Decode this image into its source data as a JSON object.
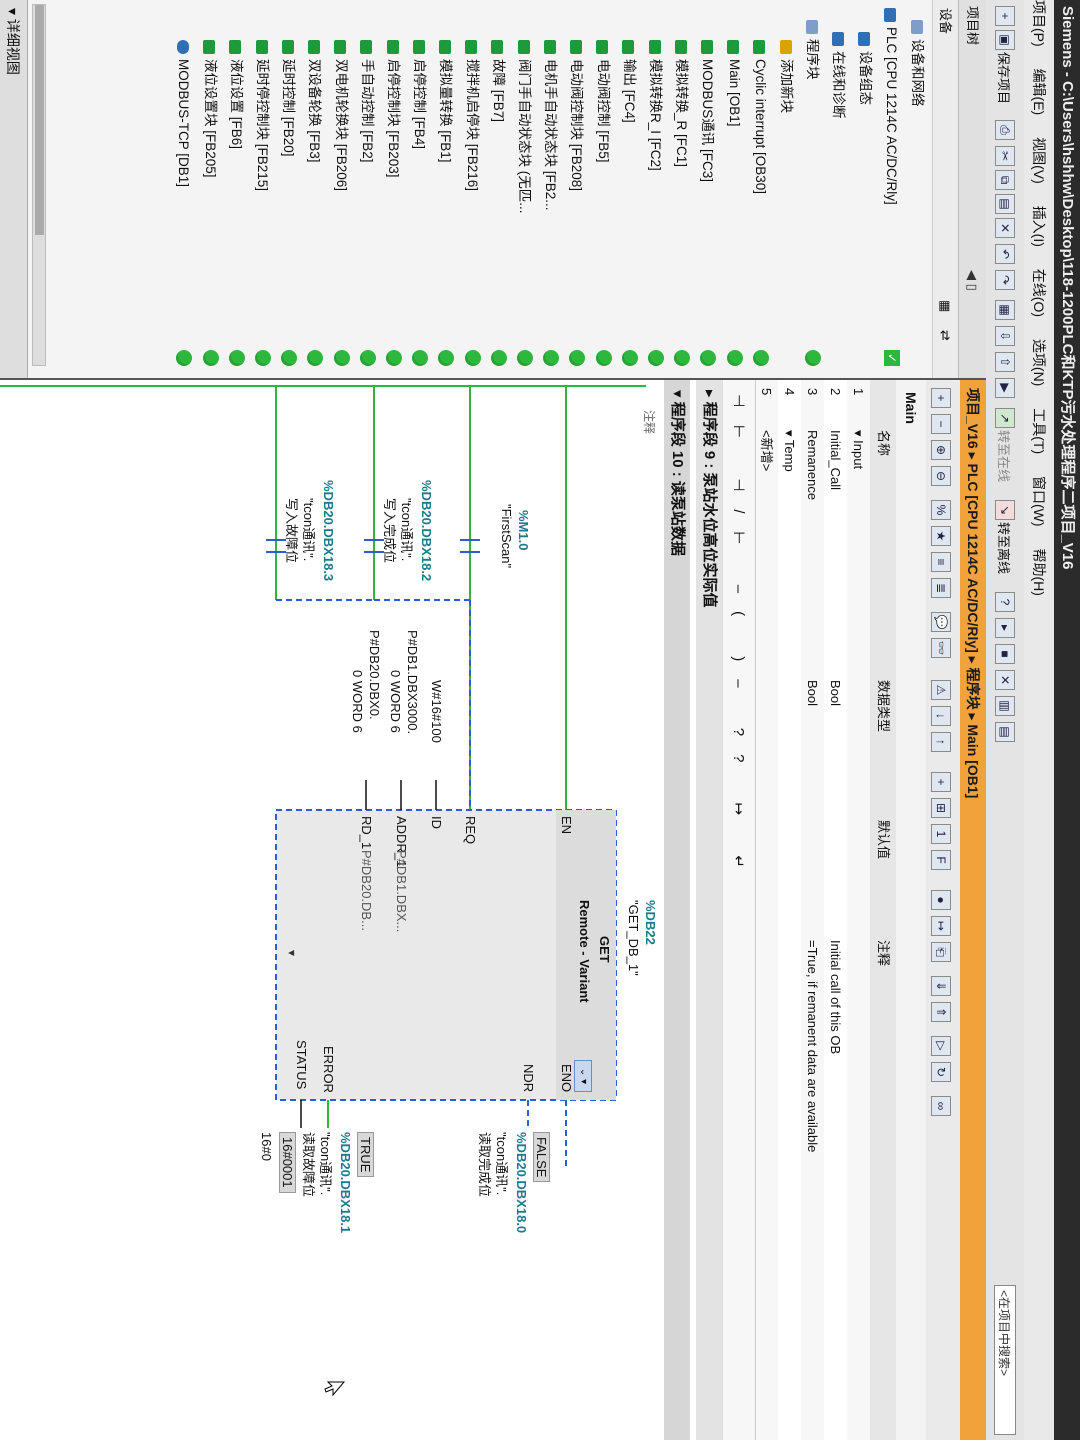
{
  "window": {
    "title": "Siemens  -  C:\\Users\\hshhw\\Desktop\\118-1200PLC和KTP污水处理程序二项目_V16"
  },
  "menu": [
    "项目(P)",
    "编辑(E)",
    "视图(V)",
    "插入(I)",
    "在线(O)",
    "选项(N)",
    "工具(T)",
    "窗口(W)",
    "帮助(H)"
  ],
  "toolbar": {
    "save_label": "保存项目",
    "go_online": "转至在线",
    "go_offline": "转至离线",
    "search_placeholder": "<在项目中搜索>"
  },
  "project_tree": {
    "header": "项目树",
    "device_tab": "设备",
    "items": [
      {
        "label": "设备和网络",
        "icon": "network-icon",
        "status": "none"
      },
      {
        "label": "PLC [CPU 1214C AC/DC/Rly]",
        "icon": "plc-icon",
        "status": "check"
      },
      {
        "label": "设备组态",
        "icon": "device-config-icon",
        "status": "none"
      },
      {
        "label": "在线和诊断",
        "icon": "diagnostics-icon",
        "status": "none"
      },
      {
        "label": "程序块",
        "icon": "folder-icon",
        "status": "green"
      },
      {
        "label": "添加新块",
        "icon": "add-block-icon",
        "status": "none"
      },
      {
        "label": "Cyclic interrupt [OB30]",
        "icon": "block-icon",
        "status": "green"
      },
      {
        "label": "Main [OB1]",
        "icon": "block-icon",
        "status": "green"
      },
      {
        "label": "MODBUS通讯 [FC3]",
        "icon": "block-icon",
        "status": "green"
      },
      {
        "label": "模拟转换_R [FC1]",
        "icon": "block-icon",
        "status": "green"
      },
      {
        "label": "模拟转换R_I [FC2]",
        "icon": "block-icon",
        "status": "green"
      },
      {
        "label": "输出 [FC4]",
        "icon": "block-icon",
        "status": "green"
      },
      {
        "label": "电动阀控制 [FB5]",
        "icon": "block-icon",
        "status": "green"
      },
      {
        "label": "电动阀控制块 [FB208]",
        "icon": "block-icon",
        "status": "green"
      },
      {
        "label": "电机手自动状态块 [FB2...",
        "icon": "block-icon",
        "status": "green"
      },
      {
        "label": "阀门手自动状态块 (无匹...",
        "icon": "block-icon",
        "status": "green"
      },
      {
        "label": "故障 [FB7]",
        "icon": "block-icon",
        "status": "green"
      },
      {
        "label": "搅拌机启停块 [FB216]",
        "icon": "block-icon",
        "status": "green"
      },
      {
        "label": "模拟量转换 [FB1]",
        "icon": "block-icon",
        "status": "green"
      },
      {
        "label": "启停控制 [FB4]",
        "icon": "block-icon",
        "status": "green"
      },
      {
        "label": "启停控制块 [FB203]",
        "icon": "block-icon",
        "status": "green"
      },
      {
        "label": "手自动控制 [FB2]",
        "icon": "block-icon",
        "status": "green"
      },
      {
        "label": "双电机轮换块 [FB206]",
        "icon": "block-icon",
        "status": "green"
      },
      {
        "label": "双设备轮换 [FB3]",
        "icon": "block-icon",
        "status": "green"
      },
      {
        "label": "延时控制 [FB20]",
        "icon": "block-icon",
        "status": "green"
      },
      {
        "label": "延时停控制块 [FB215]",
        "icon": "block-icon",
        "status": "green"
      },
      {
        "label": "液位设置 [FB6]",
        "icon": "block-icon",
        "status": "green"
      },
      {
        "label": "液位设置块 [FB205]",
        "icon": "block-icon",
        "status": "green"
      },
      {
        "label": "MODBUS-TCP [DB1]",
        "icon": "db-icon",
        "status": "green"
      }
    ],
    "footer": "详细视图"
  },
  "editor": {
    "breadcrumb": "项目_V16  ▸  PLC [CPU 1214C AC/DC/Rly]  ▸  程序块  ▸  Main [OB1]",
    "block_name": "Main",
    "interface_headers": {
      "name": "名称",
      "datatype": "数据类型",
      "default": "默认值",
      "comment": "注释"
    },
    "interface_rows": [
      {
        "num": "1",
        "name": "▾ Input",
        "datatype": "",
        "comment": ""
      },
      {
        "num": "2",
        "name": "Initial_Call",
        "datatype": "Bool",
        "comment": "Initial call of this OB"
      },
      {
        "num": "3",
        "name": "Remanence",
        "datatype": "Bool",
        "comment": "=True, if remanent data are available"
      },
      {
        "num": "4",
        "name": "▾ Temp",
        "datatype": "",
        "comment": ""
      },
      {
        "num": "5",
        "name": "<新增>",
        "datatype": "",
        "comment": ""
      }
    ],
    "ladder_tools": "⊣⊢ ⊣/⊢ –( )– ?? ↦ ↵",
    "networks": [
      {
        "title": "程序段 9 :   泵站水位高位实际值"
      },
      {
        "title": "程序段 10 :   读泵站数据",
        "comment": "注释"
      }
    ],
    "ladder": {
      "contacts": [
        {
          "addr": "%M1.0",
          "sym": "\"FirstScan\""
        },
        {
          "addr": "%DB20.DBX18.2",
          "sym": "\"tcon通讯\".",
          "sym2": "写入完成位"
        },
        {
          "addr": "%DB20.DBX18.3",
          "sym": "\"tcon通讯\".",
          "sym2": "写入故障位"
        }
      ],
      "block": {
        "db": "%DB22",
        "db_sym": "\"GET_DB_1\"",
        "name": "GET",
        "subtitle": "Remote - Variant"
      },
      "inputs": [
        {
          "pin": "EN",
          "param": ""
        },
        {
          "pin": "REQ",
          "param": ""
        },
        {
          "pin": "ID",
          "param": "W#16#100"
        },
        {
          "pin": "ADDR_1",
          "param": "P#DB1.DBX3000.",
          "param2": "0 WORD 6"
        },
        {
          "pin": "RD_1",
          "param": "P#DB20.DBX0.",
          "param2": "0 WORD 6"
        }
      ],
      "input_previews": {
        "addr": "P#DB1.DBX...",
        "rd": "P#DB20.DB..."
      },
      "outputs": [
        {
          "pin": "ENO"
        },
        {
          "pin": "NDR",
          "state": "FALSE",
          "addr": "%DB20.DBX18.0",
          "sym": "\"tcon通讯\".",
          "sym2": "读取完成位"
        },
        {
          "pin": "ERROR",
          "state": "TRUE",
          "addr": "%DB20.DBX18.1",
          "sym": "\"tcon通讯\".",
          "sym2": "读取故障位"
        },
        {
          "pin": "STATUS",
          "value_box": "16#0001",
          "value": "16#0"
        }
      ]
    }
  }
}
